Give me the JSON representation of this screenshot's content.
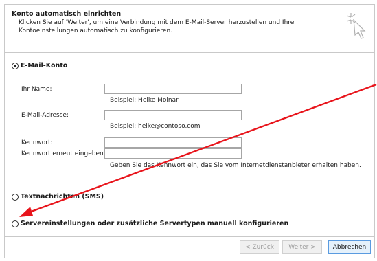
{
  "header": {
    "title": "Konto automatisch einrichten",
    "description": "Klicken Sie auf 'Weiter', um eine Verbindung mit dem E-Mail-Server herzustellen und Ihre Kontoeinstellungen automatisch zu konfigurieren.",
    "icon": "wizard-wand-icon"
  },
  "email_account": {
    "label": "E-Mail-Konto",
    "selected": true,
    "fields": {
      "name": {
        "label": "Ihr Name:",
        "value": "",
        "hint": "Beispiel: Heike Molnar"
      },
      "email": {
        "label": "E-Mail-Adresse:",
        "value": "",
        "hint": "Beispiel: heike@contoso.com"
      },
      "password": {
        "label": "Kennwort:",
        "value": ""
      },
      "password_confirm": {
        "label": "Kennwort erneut eingeben:",
        "value": "",
        "hint": "Geben Sie das Kennwort ein, das Sie vom Internetdienstanbieter erhalten haben."
      }
    }
  },
  "sms_option": {
    "label": "Textnachrichten (SMS)",
    "selected": false
  },
  "manual_option": {
    "label": "Servereinstellungen oder zusätzliche Servertypen manuell konfigurieren",
    "selected": false
  },
  "footer": {
    "back_label": "< Zurück",
    "next_label": "Weiter >",
    "cancel_label": "Abbrechen"
  },
  "colors": {
    "annotation_arrow": "#e8141b"
  }
}
